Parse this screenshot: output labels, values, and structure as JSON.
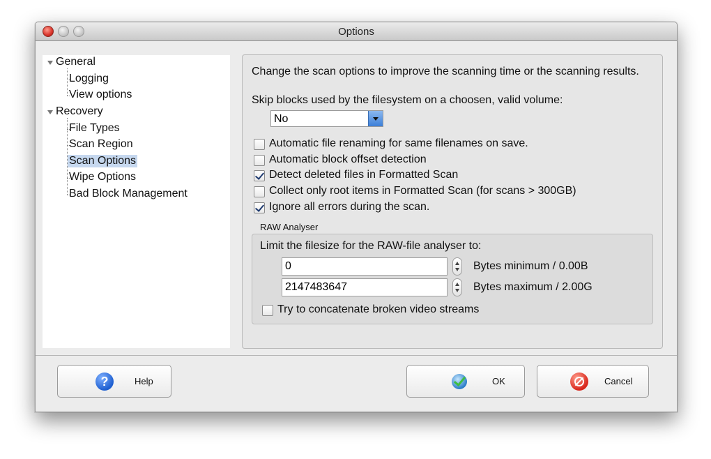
{
  "window": {
    "title": "Options"
  },
  "tree": {
    "items": [
      {
        "label": "General",
        "level": 0
      },
      {
        "label": "Logging",
        "level": 1
      },
      {
        "label": "View options",
        "level": 1
      },
      {
        "label": "Recovery",
        "level": 0
      },
      {
        "label": "File Types",
        "level": 1
      },
      {
        "label": "Scan Region",
        "level": 1
      },
      {
        "label": "Scan Options",
        "level": 1,
        "selected": true
      },
      {
        "label": "Wipe Options",
        "level": 1
      },
      {
        "label": "Bad Block Management",
        "level": 1
      }
    ]
  },
  "panel": {
    "description": "Change the scan options to improve the scanning time or the scanning results.",
    "skip_label": "Skip blocks used by the filesystem on a choosen, valid volume:",
    "skip_value": "No",
    "checkboxes": [
      {
        "label": "Automatic file renaming for same filenames on save.",
        "checked": false
      },
      {
        "label": "Automatic block offset detection",
        "checked": false
      },
      {
        "label": "Detect deleted files in Formatted Scan",
        "checked": true
      },
      {
        "label": "Collect only root items in Formatted Scan (for scans > 300GB)",
        "checked": false
      },
      {
        "label": "Ignore all errors during the scan.",
        "checked": true
      }
    ],
    "raw": {
      "title": "RAW Analyser",
      "limit_label": "Limit the filesize for the RAW-file analyser to:",
      "min_value": "0",
      "min_label": "Bytes minimum / 0.00B",
      "max_value": "2147483647",
      "max_label": "Bytes maximum / 2.00G",
      "concat_label": "Try to concatenate broken video streams",
      "concat_checked": false
    }
  },
  "buttons": {
    "help": "Help",
    "ok": "OK",
    "cancel": "Cancel"
  },
  "icons": {
    "help": "help-icon",
    "ok": "ok-check-icon",
    "cancel": "cancel-icon"
  },
  "colors": {
    "selection": "#c6d8ef",
    "accent": "#3c7fd8"
  }
}
